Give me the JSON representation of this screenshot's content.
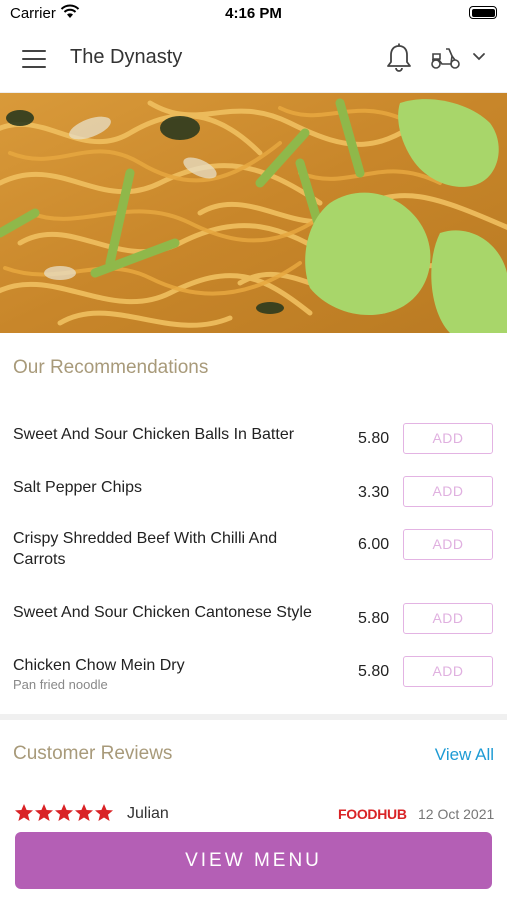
{
  "status_bar": {
    "carrier": "Carrier",
    "time": "4:16 PM"
  },
  "header": {
    "title": "The Dynasty",
    "icons": [
      "menu-icon",
      "bell-icon",
      "scooter-icon",
      "chevron-down-icon"
    ]
  },
  "recommendations": {
    "title": "Our Recommendations",
    "items": [
      {
        "name": "Sweet And Sour Chicken Balls In Batter",
        "price": "5.80",
        "add_label": "ADD"
      },
      {
        "name": "Salt Pepper Chips",
        "price": "3.30",
        "add_label": "ADD"
      },
      {
        "name": "Crispy Shredded Beef With Chilli And Carrots",
        "price": "6.00",
        "add_label": "ADD"
      },
      {
        "name": "Sweet And Sour Chicken Cantonese Style",
        "price": "5.80",
        "add_label": "ADD"
      },
      {
        "name": "Chicken Chow Mein Dry",
        "description": "Pan fried noodle",
        "price": "5.80",
        "add_label": "ADD"
      }
    ]
  },
  "reviews": {
    "title": "Customer Reviews",
    "view_all": "View All",
    "items": [
      {
        "rating": 5,
        "reviewer": "Julian",
        "source": "FOODHUB",
        "date": "12 Oct 2021"
      }
    ]
  },
  "footer": {
    "button_label": "VIEW MENU"
  },
  "colors": {
    "accent": "#b45fb5",
    "section_title": "#a89a7a",
    "link": "#1e9bd4",
    "star": "#d92326"
  }
}
